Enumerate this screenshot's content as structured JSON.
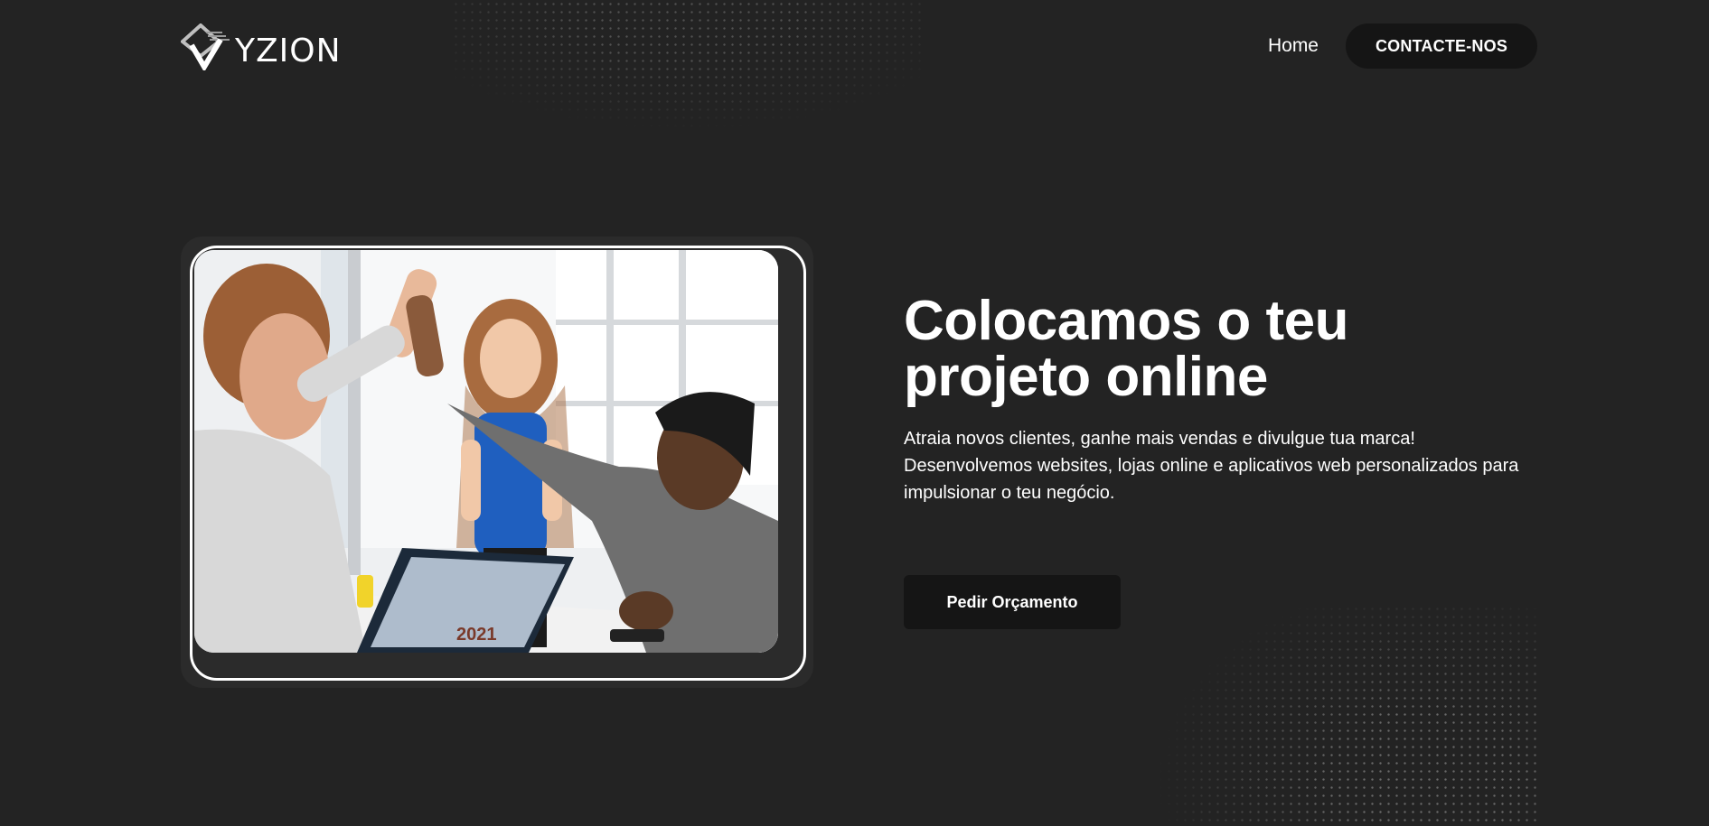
{
  "brand": {
    "name": "YZION",
    "logo_icon": "diamond-v-logo-icon"
  },
  "nav": {
    "home_label": "Home",
    "contact_label": "CONTACTE-NOS"
  },
  "hero": {
    "title": "Colocamos o teu projeto online",
    "description": "Atraia novos clientes, ganhe mais vendas e divulgue tua marca! Desenvolvemos websites, lojas online e aplicativos web personalizados para impulsionar o teu negócio.",
    "cta_label": "Pedir Orçamento",
    "image_year_on_laptop": "2021"
  },
  "colors": {
    "background": "#232323",
    "button_dark": "#151515",
    "card": "#2b2b2b",
    "text": "#ffffff"
  }
}
